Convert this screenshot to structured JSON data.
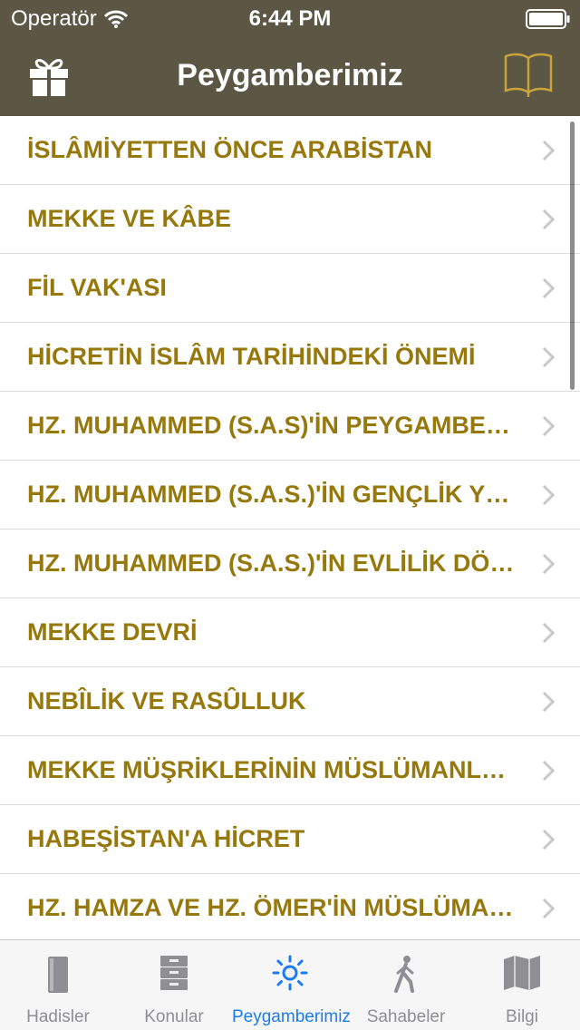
{
  "status": {
    "carrier": "Operatör",
    "time": "6:44 PM"
  },
  "nav": {
    "title": "Peygamberimiz"
  },
  "rows": [
    "İSLÂMİYETTEN ÖNCE ARABİSTAN",
    "MEKKE VE KÂBE",
    "FİL VAK'ASI",
    "HİCRETİN İSLÂM TARİHİNDEKİ ÖNEMİ",
    "HZ. MUHAMMED (S.A.S)'İN PEYGAMBERLİKTEN ÖNCEKİ HAYATI",
    "HZ. MUHAMMED (S.A.S.)'İN GENÇLİK YILLARI",
    "HZ. MUHAMMED (S.A.S.)'İN EVLİLİK DÖNEMİ",
    "MEKKE DEVRİ",
    "NEBÎLİK VE RASÛLLUK",
    "MEKKE MÜŞRİKLERİNİN MÜSLÜMANLARA ZULÜMLERİ",
    "HABEŞİSTAN'A HİCRET",
    "HZ. HAMZA VE HZ. ÖMER'İN MÜSLÜMAN OLUŞU"
  ],
  "tabs": [
    {
      "label": "Hadisler",
      "icon": "book-stack-icon",
      "active": false
    },
    {
      "label": "Konular",
      "icon": "cabinet-icon",
      "active": false
    },
    {
      "label": "Peygamberimiz",
      "icon": "sun-icon",
      "active": true
    },
    {
      "label": "Sahabeler",
      "icon": "walking-person-icon",
      "active": false
    },
    {
      "label": "Bilgi",
      "icon": "map-icon",
      "active": false
    }
  ],
  "colors": {
    "bar": "#5b5744",
    "row_text": "#96780c",
    "book_icon": "#c9a43a",
    "tab_active": "#1a7cf0",
    "tab_inactive": "#8e8e93"
  }
}
